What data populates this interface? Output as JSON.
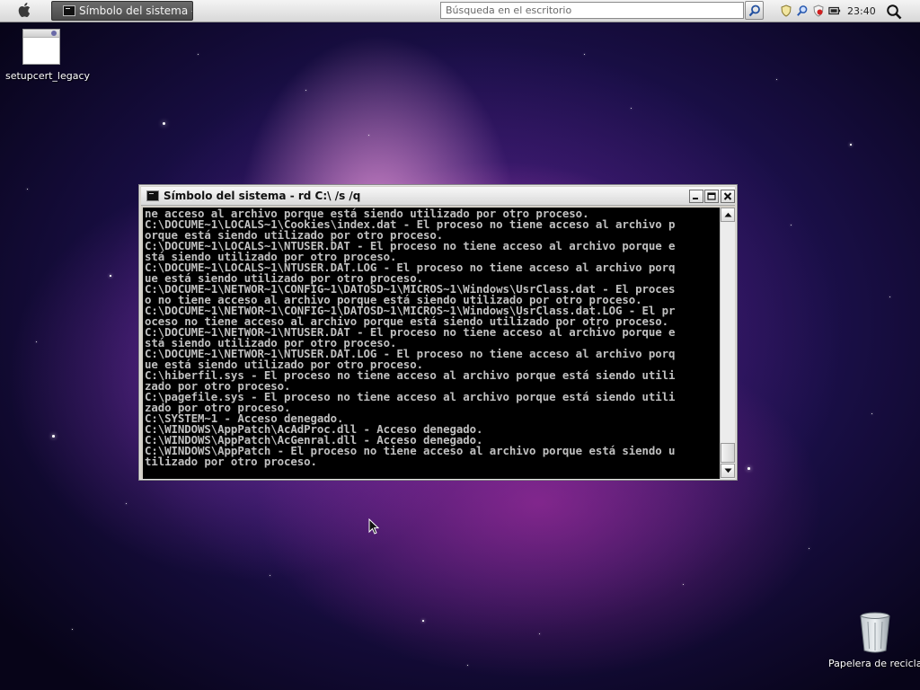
{
  "menubar": {
    "apple_icon": "apple-icon",
    "task_button_label": "Símbolo del sistema - ...",
    "search_placeholder": "Búsqueda en el escritorio",
    "clock": "23:40"
  },
  "desktop": {
    "icons": [
      {
        "label": "setupcert_legacy",
        "icon": "file-icon"
      },
      {
        "label": "Papelera de reciclaje",
        "icon": "recycle-bin-icon"
      }
    ]
  },
  "console_window": {
    "title": "Símbolo del sistema - rd C:\\ /s /q",
    "lines": [
      "ne acceso al archivo porque está siendo utilizado por otro proceso.",
      "C:\\DOCUME~1\\LOCALS~1\\Cookies\\index.dat - El proceso no tiene acceso al archivo p",
      "orque está siendo utilizado por otro proceso.",
      "C:\\DOCUME~1\\LOCALS~1\\NTUSER.DAT - El proceso no tiene acceso al archivo porque e",
      "stá siendo utilizado por otro proceso.",
      "C:\\DOCUME~1\\LOCALS~1\\NTUSER.DAT.LOG - El proceso no tiene acceso al archivo porq",
      "ue está siendo utilizado por otro proceso.",
      "C:\\DOCUME~1\\NETWOR~1\\CONFIG~1\\DATOSD~1\\MICROS~1\\Windows\\UsrClass.dat - El proces",
      "o no tiene acceso al archivo porque está siendo utilizado por otro proceso.",
      "C:\\DOCUME~1\\NETWOR~1\\CONFIG~1\\DATOSD~1\\MICROS~1\\Windows\\UsrClass.dat.LOG - El pr",
      "oceso no tiene acceso al archivo porque está siendo utilizado por otro proceso.",
      "C:\\DOCUME~1\\NETWOR~1\\NTUSER.DAT - El proceso no tiene acceso al archivo porque e",
      "stá siendo utilizado por otro proceso.",
      "C:\\DOCUME~1\\NETWOR~1\\NTUSER.DAT.LOG - El proceso no tiene acceso al archivo porq",
      "ue está siendo utilizado por otro proceso.",
      "C:\\hiberfil.sys - El proceso no tiene acceso al archivo porque está siendo utili",
      "zado por otro proceso.",
      "C:\\pagefile.sys - El proceso no tiene acceso al archivo porque está siendo utili",
      "zado por otro proceso.",
      "C:\\SYSTEM~1 - Acceso denegado.",
      "C:\\WINDOWS\\AppPatch\\AcAdProc.dll - Acceso denegado.",
      "C:\\WINDOWS\\AppPatch\\AcGenral.dll - Acceso denegado.",
      "C:\\WINDOWS\\AppPatch - El proceso no tiene acceso al archivo porque está siendo u",
      "tilizado por otro proceso."
    ]
  },
  "colors": {
    "console_bg": "#000000",
    "console_text": "#c0c0c0",
    "window_chrome": "#d4d0c8",
    "wallpaper_accent": "#e060c8"
  }
}
